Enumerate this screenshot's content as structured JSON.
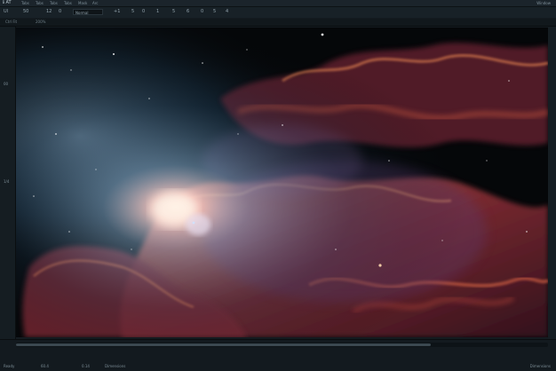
{
  "app": {
    "logo_text": "ℹ AT"
  },
  "menu": {
    "items": [
      "Tabs",
      "Tabs",
      "Tabs",
      "Tabs",
      "Mask",
      "Arc"
    ],
    "window_label": "Window"
  },
  "toolbar": {
    "mode_label": "Ul",
    "values": [
      "50",
      "12",
      "0",
      "+1",
      "5",
      "0",
      "1",
      "5",
      "6",
      "0",
      "5",
      "4"
    ],
    "field_label": "Normal"
  },
  "strip": {
    "labels": [
      "Ctrl Fit",
      "200%"
    ]
  },
  "leftpanel": {
    "marker_top": "00",
    "marker_mid": "1/4"
  },
  "statusbar": {
    "scroll_fraction": 0.78,
    "items": [
      "Ready",
      "60.4",
      "0.14",
      "Dimensions"
    ],
    "right_label": "Dimensions"
  },
  "colors": {
    "nebula_red": "#b84a3a",
    "nebula_blue": "#8fb7d8",
    "space": "#050709"
  }
}
